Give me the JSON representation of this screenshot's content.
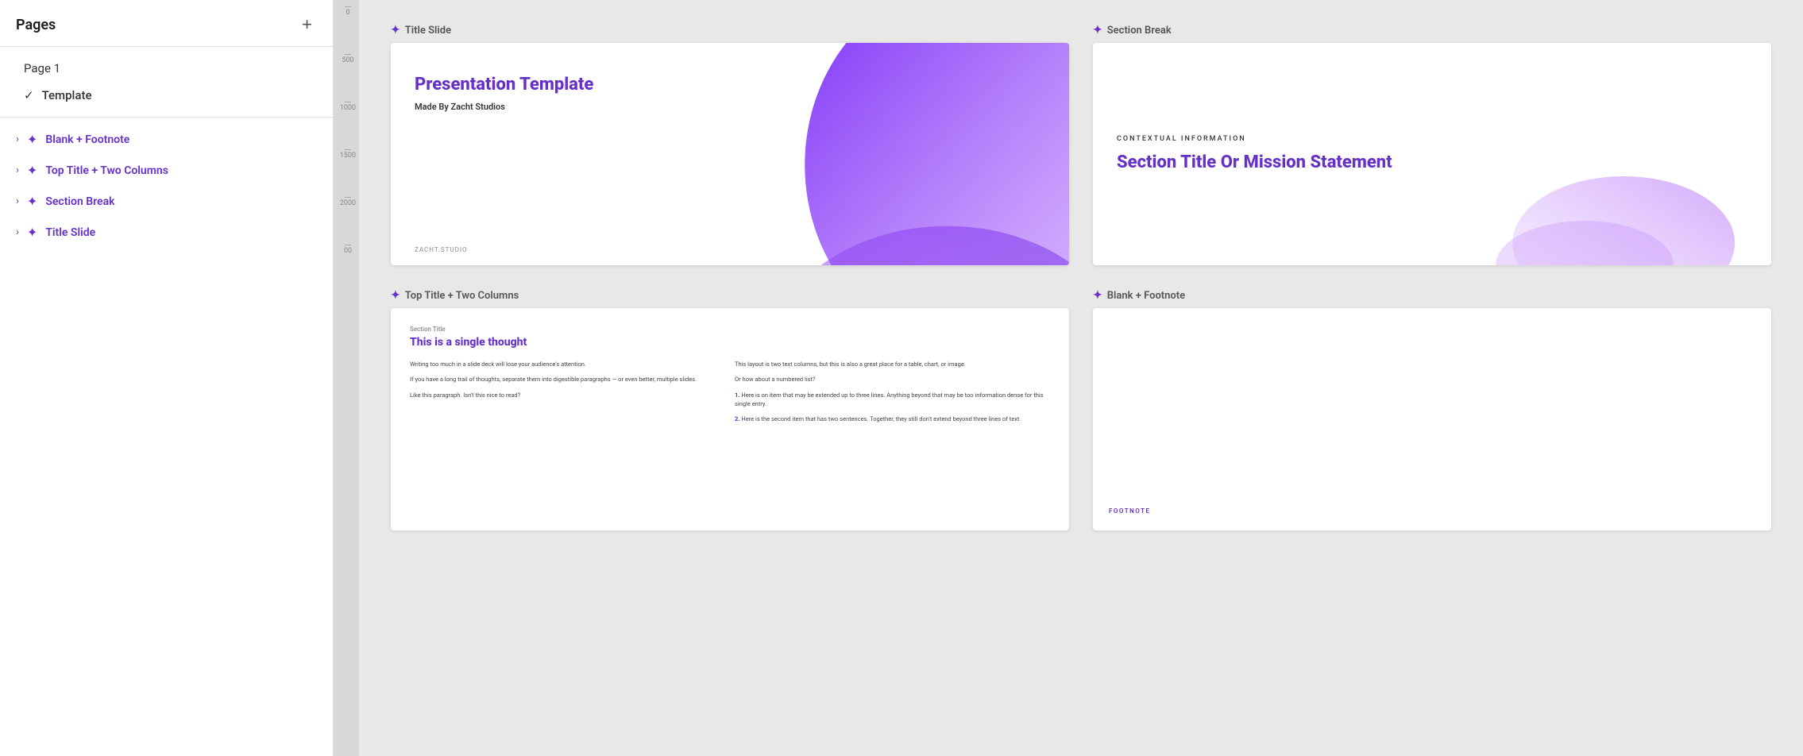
{
  "sidebar": {
    "title": "Pages",
    "add_button": "+",
    "pages": [
      {
        "id": "page1",
        "label": "Page 1",
        "active": false,
        "checked": false
      },
      {
        "id": "template",
        "label": "Template",
        "active": true,
        "checked": true
      }
    ],
    "slides": [
      {
        "id": "blank-footnote",
        "label": "Blank + Footnote"
      },
      {
        "id": "top-title-two-col",
        "label": "Top Title + Two Columns"
      },
      {
        "id": "section-break",
        "label": "Section Break"
      },
      {
        "id": "title-slide",
        "label": "Title Slide"
      }
    ]
  },
  "canvas": {
    "slides": [
      {
        "id": "title-slide-card",
        "label": "Title Slide",
        "title": "Presentation Template",
        "subtitle": "Made By Zacht Studios",
        "footer": "ZACHT.STUDIO"
      },
      {
        "id": "section-break-card",
        "label": "Section Break",
        "eyebrow": "CONTEXTUAL INFORMATION",
        "title": "Section Title Or Mission Statement"
      },
      {
        "id": "two-col-card",
        "label": "Top Title + Two Columns",
        "section_label": "Section Title",
        "title": "This is a single thought",
        "col1": [
          "Writing too much in a slide deck will lose your audience's attention.",
          "If you have a long trail of thoughts, separate them into digestible paragraphs — or even better, multiple slides.",
          "Like this paragraph. Isn't this nice to read?"
        ],
        "col2_intro": "This layout is two text columns, but this is also a great place for a table, chart, or image.",
        "col2_question": "Or how about a numbered list?",
        "col2_items": [
          {
            "num": "1.",
            "text": "Here is on item that may be extended up to three lines. Anything beyond that may be too information dense for this single entry."
          },
          {
            "num": "2.",
            "text": "Here is the second item that has two sentences. Together, they still don't extend beyond three lines of text."
          }
        ]
      },
      {
        "id": "blank-footnote-card",
        "label": "Blank + Footnote",
        "footer": "FOOTNOTE"
      }
    ]
  },
  "ruler": {
    "marks": [
      "0",
      "500",
      "1000",
      "1500",
      "2000",
      "00"
    ]
  }
}
